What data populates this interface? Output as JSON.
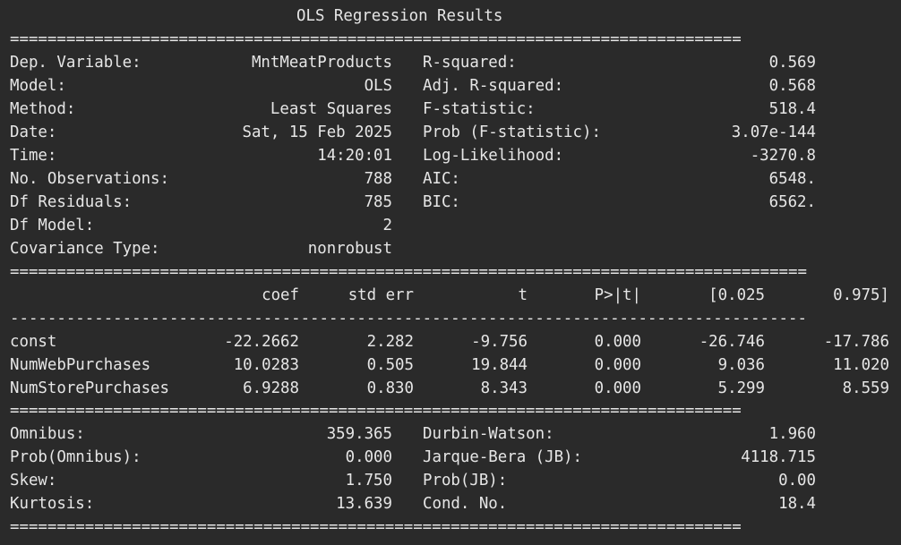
{
  "title": "OLS Regression Results",
  "rule_double_narrow": "==============================================================================",
  "rule_double_wide": "=====================================================================================",
  "rule_single_wide": "-------------------------------------------------------------------------------------",
  "top": [
    {
      "l_label": "Dep. Variable:",
      "l_value": "MntMeatProducts",
      "r_label": "R-squared:",
      "r_value": "0.569"
    },
    {
      "l_label": "Model:",
      "l_value": "OLS",
      "r_label": "Adj. R-squared:",
      "r_value": "0.568"
    },
    {
      "l_label": "Method:",
      "l_value": "Least Squares",
      "r_label": "F-statistic:",
      "r_value": "518.4"
    },
    {
      "l_label": "Date:",
      "l_value": "Sat, 15 Feb 2025",
      "r_label": "Prob (F-statistic):",
      "r_value": "3.07e-144"
    },
    {
      "l_label": "Time:",
      "l_value": "14:20:01",
      "r_label": "Log-Likelihood:",
      "r_value": "-3270.8"
    },
    {
      "l_label": "No. Observations:",
      "l_value": "788",
      "r_label": "AIC:",
      "r_value": "6548."
    },
    {
      "l_label": "Df Residuals:",
      "l_value": "785",
      "r_label": "BIC:",
      "r_value": "6562."
    },
    {
      "l_label": "Df Model:",
      "l_value": "2",
      "r_label": "",
      "r_value": ""
    },
    {
      "l_label": "Covariance Type:",
      "l_value": "nonrobust",
      "r_label": "",
      "r_value": ""
    }
  ],
  "coef_header": [
    "",
    "coef",
    "std err",
    "t",
    "P>|t|",
    "[0.025",
    "0.975]"
  ],
  "coef_rows": [
    [
      "const",
      "-22.2662",
      "2.282",
      "-9.756",
      "0.000",
      "-26.746",
      "-17.786"
    ],
    [
      "NumWebPurchases",
      "10.0283",
      "0.505",
      "19.844",
      "0.000",
      "9.036",
      "11.020"
    ],
    [
      "NumStorePurchases",
      "6.9288",
      "0.830",
      "8.343",
      "0.000",
      "5.299",
      "8.559"
    ]
  ],
  "bottom": [
    {
      "l_label": "Omnibus:",
      "l_value": "359.365",
      "r_label": "Durbin-Watson:",
      "r_value": "1.960"
    },
    {
      "l_label": "Prob(Omnibus):",
      "l_value": "0.000",
      "r_label": "Jarque-Bera (JB):",
      "r_value": "4118.715"
    },
    {
      "l_label": "Skew:",
      "l_value": "1.750",
      "r_label": "Prob(JB):",
      "r_value": "0.00"
    },
    {
      "l_label": "Kurtosis:",
      "l_value": "13.639",
      "r_label": "Cond. No.",
      "r_value": "18.4"
    }
  ],
  "colors": {
    "background": "#2a2a2a",
    "text": "#e6e6e6"
  }
}
